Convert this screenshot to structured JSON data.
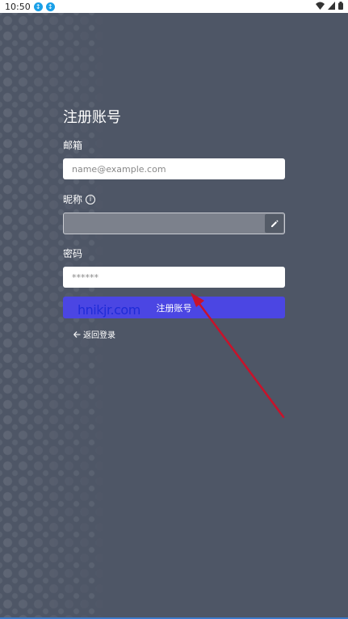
{
  "status_bar": {
    "time": "10:50",
    "notif_1": "↕",
    "notif_2": "↕"
  },
  "form": {
    "title": "注册账号",
    "email": {
      "label": "邮箱",
      "placeholder": "name@example.com",
      "value": ""
    },
    "nickname": {
      "label": "昵称",
      "info_icon": "info-icon",
      "value": ""
    },
    "password": {
      "label": "密码",
      "placeholder": "******",
      "value": ""
    },
    "submit_label": "注册账号",
    "back_label": "返回登录"
  },
  "watermark": "hnikjr.com",
  "colors": {
    "background": "#4e5666",
    "primary": "#4b46e3",
    "annotation_arrow": "#c9122a"
  }
}
